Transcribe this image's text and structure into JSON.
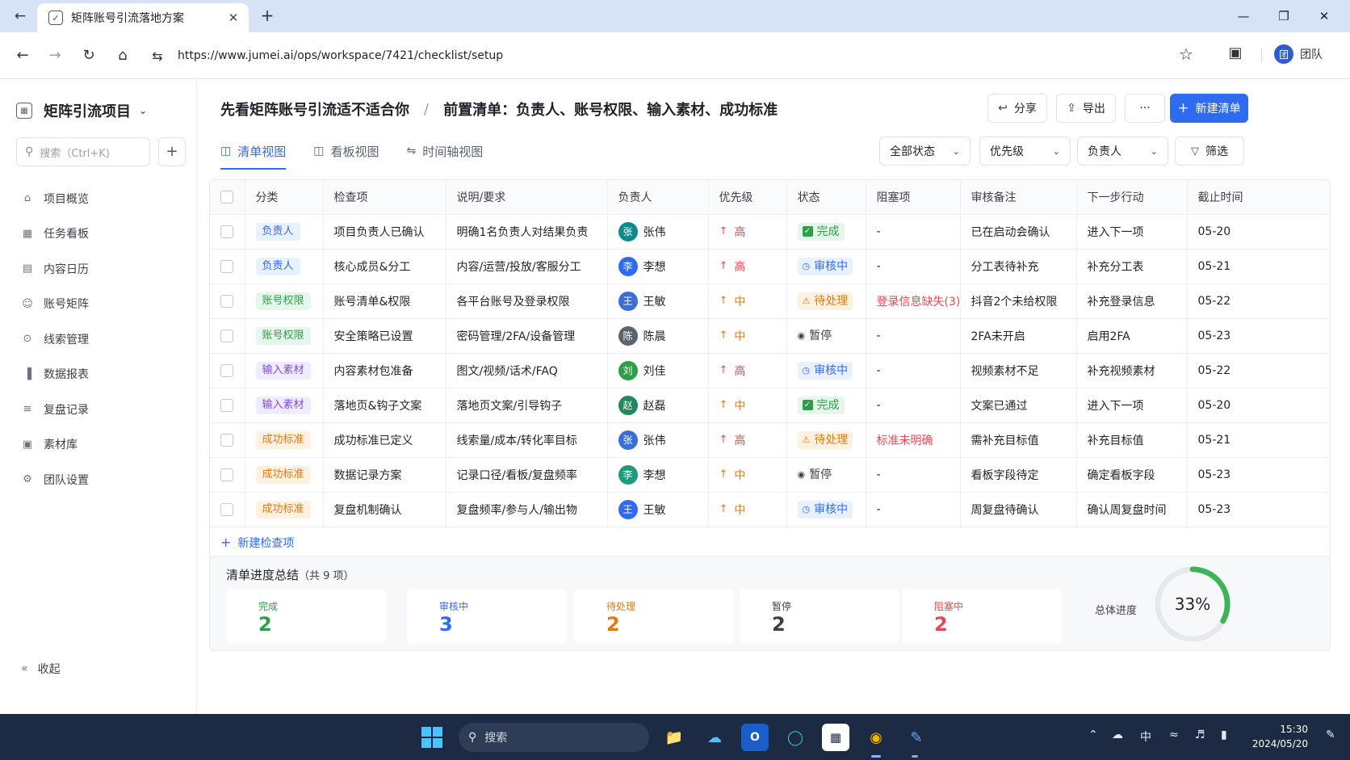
{
  "browser": {
    "tab_title": "矩阵账号引流落地方案",
    "url": "https://www.jumei.ai/ops/workspace/7421/checklist/setup",
    "profile_avatar": "团",
    "profile_name": "团队"
  },
  "sidebar": {
    "project_icon": "88",
    "project_name": "矩阵引流项目",
    "search_placeholder": "搜索（Ctrl+K)",
    "items": [
      {
        "icon": "home-icon",
        "label": "项目概览"
      },
      {
        "icon": "board-icon",
        "label": "任务看板"
      },
      {
        "icon": "calendar-icon",
        "label": "内容日历"
      },
      {
        "icon": "users-icon",
        "label": "账号矩阵"
      },
      {
        "icon": "leads-icon",
        "label": "线索管理"
      },
      {
        "icon": "chart-icon",
        "label": "数据报表"
      },
      {
        "icon": "review-icon",
        "label": "复盘记录"
      },
      {
        "icon": "library-icon",
        "label": "素材库"
      },
      {
        "icon": "gear-icon",
        "label": "团队设置"
      }
    ],
    "collapse_label": "收起"
  },
  "header": {
    "breadcrumb_1": "先看矩阵账号引流适不适合你",
    "breadcrumb_sep": "/",
    "breadcrumb_2": "前置清单：负责人、账号权限、输入素材、成功标准",
    "share_label": "分享",
    "export_label": "导出",
    "more_label": "···",
    "new_label": "新建清单"
  },
  "views": {
    "list": "清单视图",
    "board": "看板视图",
    "timeline": "时间轴视图"
  },
  "filters": {
    "status": "全部状态",
    "priority": "优先级",
    "owner": "负责人",
    "filter": "筛选"
  },
  "table": {
    "columns": [
      "分类",
      "检查项",
      "说明/要求",
      "负责人",
      "优先级",
      "状态",
      "阻塞项",
      "审核备注",
      "下一步行动",
      "截止时间"
    ],
    "rows": [
      {
        "category": "负责人",
        "cat_color": "blue",
        "item": "项目负责人已确认",
        "desc": "明确1名负责人对结果负责",
        "avatar": "张",
        "avatar_color": "#0f8a8a",
        "owner": "张伟",
        "priority": "高",
        "pri_level": "high",
        "status": "完成",
        "status_kind": "done",
        "blocker": "-",
        "blocker_red": false,
        "note": "已在启动会确认",
        "next": "进入下一项",
        "due": "05-20"
      },
      {
        "category": "负责人",
        "cat_color": "blue",
        "item": "核心成员&分工",
        "desc": "内容/运营/投放/客服分工",
        "avatar": "李",
        "avatar_color": "#2f6bf0",
        "owner": "李想",
        "priority": "高",
        "pri_level": "high",
        "status": "审核中",
        "status_kind": "review",
        "blocker": "-",
        "blocker_red": false,
        "note": "分工表待补充",
        "next": "补充分工表",
        "due": "05-21"
      },
      {
        "category": "账号权限",
        "cat_color": "green",
        "item": "账号清单&权限",
        "desc": "各平台账号及登录权限",
        "avatar": "王",
        "avatar_color": "#3a6fd8",
        "owner": "王敏",
        "priority": "中",
        "pri_level": "mid",
        "status": "待处理",
        "status_kind": "todo",
        "blocker": "登录信息缺失(3)",
        "blocker_red": true,
        "note": "抖音2个未给权限",
        "next": "补充登录信息",
        "due": "05-22"
      },
      {
        "category": "账号权限",
        "cat_color": "green",
        "item": "安全策略已设置",
        "desc": "密码管理/2FA/设备管理",
        "avatar": "陈",
        "avatar_color": "#5b6270",
        "owner": "陈晨",
        "priority": "中",
        "pri_level": "mid",
        "status": "暂停",
        "status_kind": "paused",
        "blocker": "-",
        "blocker_red": false,
        "note": "2FA未开启",
        "next": "启用2FA",
        "due": "05-23"
      },
      {
        "category": "输入素材",
        "cat_color": "purple",
        "item": "内容素材包准备",
        "desc": "图文/视频/话术/FAQ",
        "avatar": "刘",
        "avatar_color": "#2e9e48",
        "owner": "刘佳",
        "priority": "高",
        "pri_level": "high",
        "status": "审核中",
        "status_kind": "review",
        "blocker": "-",
        "blocker_red": false,
        "note": "视频素材不足",
        "next": "补充视频素材",
        "due": "05-22"
      },
      {
        "category": "输入素材",
        "cat_color": "purple",
        "item": "落地页&钩子文案",
        "desc": "落地页文案/引导钩子",
        "avatar": "赵",
        "avatar_color": "#1f8a5a",
        "owner": "赵磊",
        "priority": "中",
        "pri_level": "mid",
        "status": "完成",
        "status_kind": "done",
        "blocker": "-",
        "blocker_red": false,
        "note": "文案已通过",
        "next": "进入下一项",
        "due": "05-20"
      },
      {
        "category": "成功标准",
        "cat_color": "orange",
        "item": "成功标准已定义",
        "desc": "线索量/成本/转化率目标",
        "avatar": "张",
        "avatar_color": "#3a6fd8",
        "owner": "张伟",
        "priority": "高",
        "pri_level": "high",
        "status": "待处理",
        "status_kind": "todo",
        "blocker": "标准未明确",
        "blocker_red": true,
        "note": "需补充目标值",
        "next": "补充目标值",
        "due": "05-21"
      },
      {
        "category": "成功标准",
        "cat_color": "orange",
        "item": "数据记录方案",
        "desc": "记录口径/看板/复盘频率",
        "avatar": "李",
        "avatar_color": "#1f9a7a",
        "owner": "李想",
        "priority": "中",
        "pri_level": "mid",
        "status": "暂停",
        "status_kind": "paused",
        "blocker": "-",
        "blocker_red": false,
        "note": "看板字段待定",
        "next": "确定看板字段",
        "due": "05-23"
      },
      {
        "category": "成功标准",
        "cat_color": "orange",
        "item": "复盘机制确认",
        "desc": "复盘频率/参与人/输出物",
        "avatar": "王",
        "avatar_color": "#2f6bf0",
        "owner": "王敏",
        "priority": "中",
        "pri_level": "mid",
        "status": "审核中",
        "status_kind": "review",
        "blocker": "-",
        "blocker_red": false,
        "note": "周复盘待确认",
        "next": "确认周复盘时间",
        "due": "05-23"
      }
    ],
    "add_row_label": "新建检查项"
  },
  "summary": {
    "title": "清单进度总结",
    "count_text": "（共 9 项）",
    "cards": [
      {
        "label": "完成",
        "value": "2",
        "color": "#2e9e48"
      },
      {
        "label": "审核中",
        "value": "3",
        "color": "#2f6bf0"
      },
      {
        "label": "待处理",
        "value": "2",
        "color": "#e07b12"
      },
      {
        "label": "暂停",
        "value": "2",
        "color": "#3b4048"
      },
      {
        "label": "阻塞中",
        "value": "2",
        "color": "#e5484d"
      }
    ],
    "total_label": "总体进度",
    "progress_text": "33%",
    "progress_fraction": 0.33,
    "progress_color": "#3fb35a"
  },
  "taskbar": {
    "search_label": "搜索",
    "time": "15:30",
    "date": "2024/05/20",
    "ime": "中"
  }
}
